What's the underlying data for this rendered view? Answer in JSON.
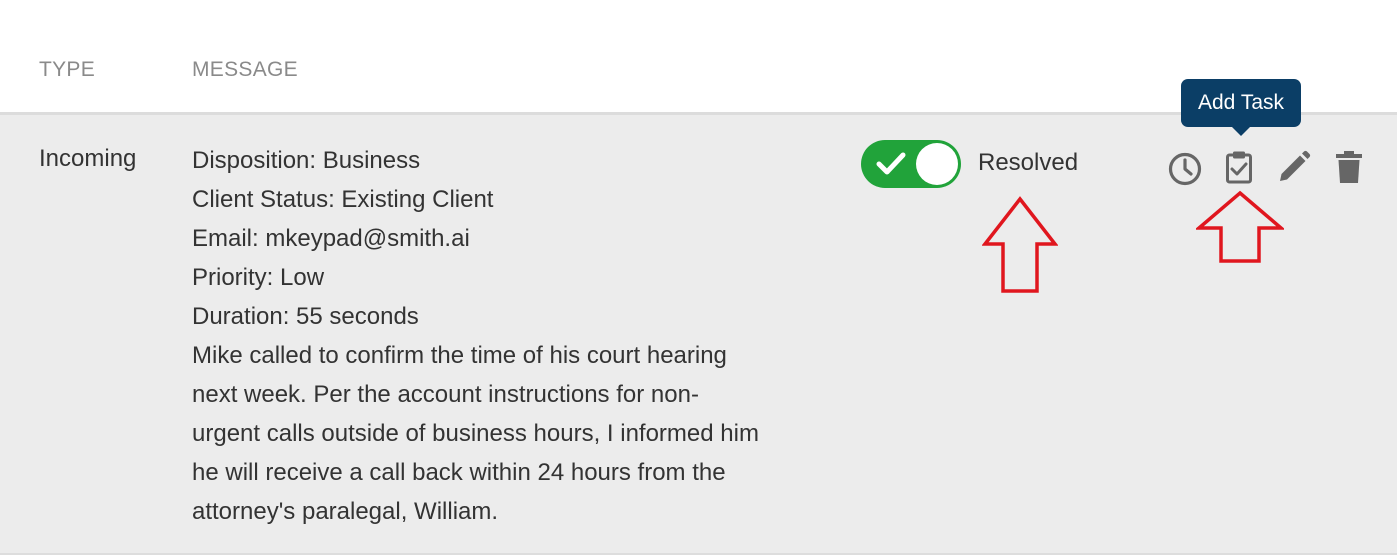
{
  "table": {
    "headers": {
      "type": "TYPE",
      "message": "MESSAGE"
    },
    "row": {
      "type": "Incoming",
      "message_lines": [
        "Disposition: Business",
        "Client Status: Existing Client",
        "Email: mkeypad@smith.ai",
        "Priority: Low",
        "Duration: 55 seconds",
        "Mike called to confirm the time of his court hearing",
        "next week. Per the account instructions for non-",
        "urgent calls outside of business hours, I informed him",
        "he will receive a call back within 24 hours from the",
        "attorney's paralegal, William."
      ],
      "resolved_toggle": {
        "label": "Resolved",
        "checked": true,
        "color": "#21a33a"
      },
      "actions": [
        {
          "icon": "clock-icon"
        },
        {
          "icon": "clipboard-check-icon"
        },
        {
          "icon": "pencil-icon"
        },
        {
          "icon": "trash-icon"
        }
      ]
    }
  },
  "tooltip": {
    "text": "Add Task",
    "color": "#0b3e66"
  },
  "annotation_color": "#e0161e"
}
